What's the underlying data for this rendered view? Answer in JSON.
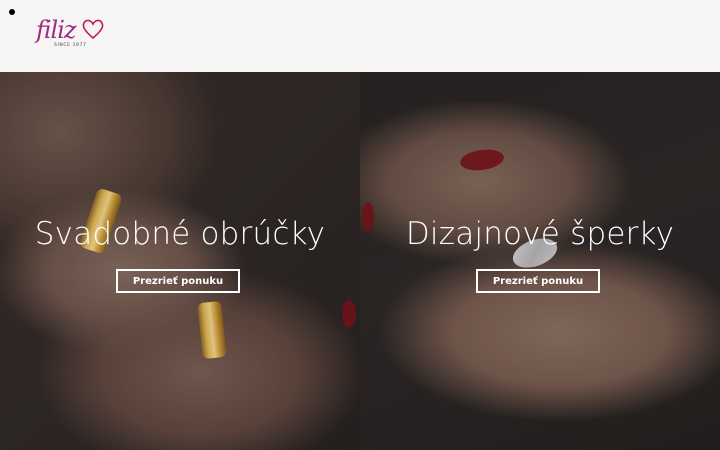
{
  "header": {
    "logo": {
      "brand": "filiz",
      "since": "SINCE 1977"
    }
  },
  "panels": [
    {
      "title": "Svadobné obrúčky",
      "button_label": "Prezrieť ponuku"
    },
    {
      "title": "Dizajnové šperky",
      "button_label": "Prezrieť ponuku"
    }
  ],
  "colors": {
    "header_bg": "#f7f5f4",
    "logo_accent": "#9b2c82",
    "overlay_text": "#ffffff"
  }
}
